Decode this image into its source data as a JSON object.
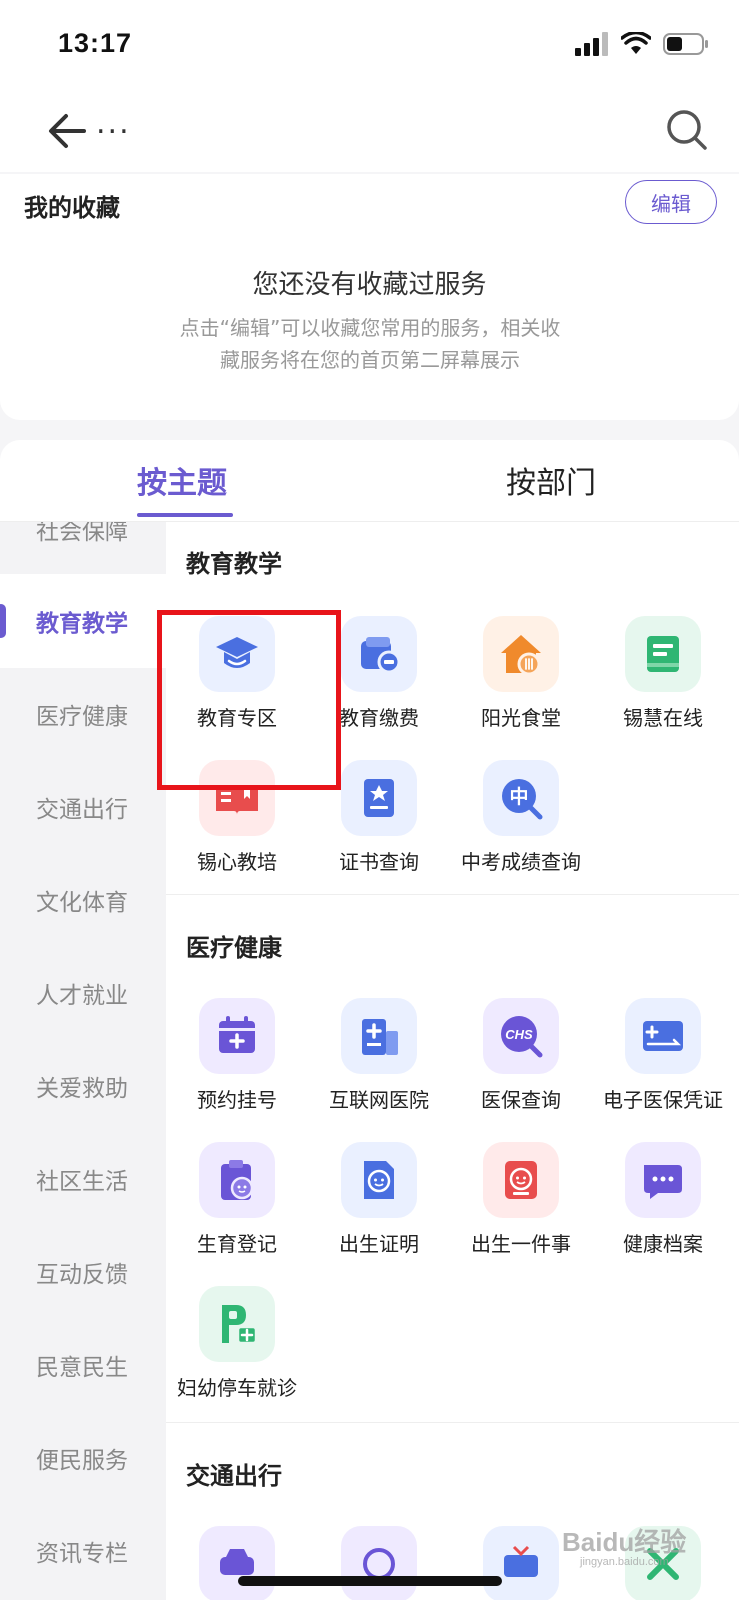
{
  "status_bar": {
    "time": "13:17"
  },
  "nav": {
    "title": "..."
  },
  "favorites": {
    "title": "我的收藏",
    "edit_label": "编辑",
    "empty_title": "您还没有收藏过服务",
    "empty_desc": "点击“编辑”可以收藏您常用的服务，相关收藏服务将在您的首页第二屏幕展示"
  },
  "tabs": [
    {
      "label": "按主题",
      "active": true
    },
    {
      "label": "按部门",
      "active": false
    }
  ],
  "sidebar": {
    "items": [
      {
        "label": "社会保障"
      },
      {
        "label": "教育教学",
        "active": true
      },
      {
        "label": "医疗健康"
      },
      {
        "label": "交通出行"
      },
      {
        "label": "文化体育"
      },
      {
        "label": "人才就业"
      },
      {
        "label": "关爱救助"
      },
      {
        "label": "社区生活"
      },
      {
        "label": "互动反馈"
      },
      {
        "label": "民意民生"
      },
      {
        "label": "便民服务"
      },
      {
        "label": "资讯专栏"
      }
    ]
  },
  "sections": [
    {
      "title": "教育教学",
      "items": [
        {
          "label": "教育专区",
          "icon": "graduation-cap-icon",
          "color": "#4a6fe0"
        },
        {
          "label": "教育缴费",
          "icon": "wallet-icon",
          "color": "#4a6fe0"
        },
        {
          "label": "阳光食堂",
          "icon": "canteen-icon",
          "color": "#f08a2c"
        },
        {
          "label": "锡慧在线",
          "icon": "online-class-icon",
          "color": "#2fb673"
        },
        {
          "label": "锡心教培",
          "icon": "book-icon",
          "color": "#e84d4d"
        },
        {
          "label": "证书查询",
          "icon": "certificate-icon",
          "color": "#4a6fe0"
        },
        {
          "label": "中考成绩查询",
          "icon": "exam-search-icon",
          "color": "#4a6fe0",
          "glyph": "中"
        }
      ]
    },
    {
      "title": "医疗健康",
      "items": [
        {
          "label": "预约挂号",
          "icon": "calendar-plus-icon",
          "color": "#6a55d6"
        },
        {
          "label": "互联网医院",
          "icon": "hospital-icon",
          "color": "#4a6fe0"
        },
        {
          "label": "医保查询",
          "icon": "chs-search-icon",
          "color": "#6a55d6",
          "glyph": "CHS"
        },
        {
          "label": "电子医保凭证",
          "icon": "insurance-card-icon",
          "color": "#4a6fe0"
        },
        {
          "label": "生育登记",
          "icon": "birth-register-icon",
          "color": "#6a55d6"
        },
        {
          "label": "出生证明",
          "icon": "birth-certificate-icon",
          "color": "#4a6fe0"
        },
        {
          "label": "出生一件事",
          "icon": "baby-icon",
          "color": "#e84d4d"
        },
        {
          "label": "健康档案",
          "icon": "chat-record-icon",
          "color": "#6a55d6"
        },
        {
          "label": "妇幼停车就诊",
          "icon": "parking-medical-icon",
          "color": "#2fb673",
          "glyph": "P"
        }
      ]
    },
    {
      "title": "交通出行",
      "items": []
    }
  ],
  "watermark": {
    "text": "Baidu经验",
    "sub": "jingyan.baidu.com"
  }
}
